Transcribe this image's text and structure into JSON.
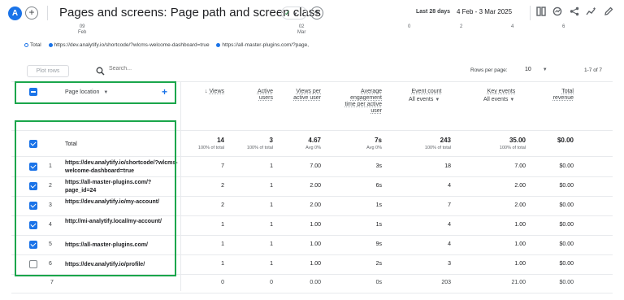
{
  "header": {
    "avatar_letter": "A",
    "title": "Pages and screens: Page path and screen class",
    "date_label": "Last 28 days",
    "date_range": "4 Feb - 3 Mar 2025"
  },
  "chart_remnants": {
    "x_ticks_left": [
      {
        "top": "09",
        "bottom": "Feb"
      },
      {
        "top": "02",
        "bottom": "Mar"
      }
    ],
    "x_ticks_right": [
      "0",
      "2",
      "4",
      "6"
    ]
  },
  "legend": {
    "items": [
      "Total",
      "https://dev.analytify.io/shortcode/?wlcms-welcome-dashboard=true",
      "https://all-master-plugins.com/?page,"
    ]
  },
  "toolbar": {
    "plot_rows": "Plot rows",
    "search_placeholder": "Search...",
    "rows_per_page_label": "Rows per page:",
    "rows_per_page_value": "10",
    "pager": "1-7 of 7"
  },
  "table": {
    "dimension_header": "Page location",
    "columns": [
      {
        "title": "Views",
        "sub": ""
      },
      {
        "title": "Active users",
        "sub": ""
      },
      {
        "title": "Views per active user",
        "sub": ""
      },
      {
        "title": "Average engagement time per active user",
        "sub": ""
      },
      {
        "title": "Event count",
        "sub": "All events"
      },
      {
        "title": "Key events",
        "sub": "All events"
      },
      {
        "title": "Total revenue",
        "sub": ""
      }
    ],
    "total_label": "Total",
    "totals": [
      {
        "value": "14",
        "sub": "100% of total"
      },
      {
        "value": "3",
        "sub": "100% of total"
      },
      {
        "value": "4.67",
        "sub": "Avg 0%"
      },
      {
        "value": "7s",
        "sub": "Avg 0%"
      },
      {
        "value": "243",
        "sub": "100% of total"
      },
      {
        "value": "35.00",
        "sub": "100% of total"
      },
      {
        "value": "$0.00",
        "sub": ""
      }
    ],
    "rows": [
      {
        "n": "1",
        "checked": true,
        "page": "https://dev.analytify.io/shortcode/?wlcms-welcome-dashboard=true",
        "values": [
          "7",
          "1",
          "7.00",
          "3s",
          "18",
          "7.00",
          "$0.00"
        ]
      },
      {
        "n": "2",
        "checked": true,
        "page": "https://all-master-plugins.com/?page_id=24",
        "values": [
          "2",
          "1",
          "2.00",
          "6s",
          "4",
          "2.00",
          "$0.00"
        ]
      },
      {
        "n": "3",
        "checked": true,
        "page": "https://dev.analytify.io/my-account/",
        "values": [
          "2",
          "1",
          "2.00",
          "1s",
          "7",
          "2.00",
          "$0.00"
        ]
      },
      {
        "n": "4",
        "checked": true,
        "page": "http://mi-analytify.local/my-account/",
        "values": [
          "1",
          "1",
          "1.00",
          "1s",
          "4",
          "1.00",
          "$0.00"
        ]
      },
      {
        "n": "5",
        "checked": true,
        "page": "https://all-master-plugins.com/",
        "values": [
          "1",
          "1",
          "1.00",
          "9s",
          "4",
          "1.00",
          "$0.00"
        ]
      },
      {
        "n": "6",
        "checked": false,
        "page": "https://dev.analytify.io/profile/",
        "values": [
          "1",
          "1",
          "1.00",
          "2s",
          "3",
          "1.00",
          "$0.00"
        ]
      }
    ],
    "footer_row": {
      "n": "7",
      "values": [
        "0",
        "0",
        "0.00",
        "0s",
        "203",
        "21.00",
        "$0.00"
      ]
    }
  },
  "colors": {
    "accent": "#1a73e8",
    "highlight": "#1aa64b"
  }
}
